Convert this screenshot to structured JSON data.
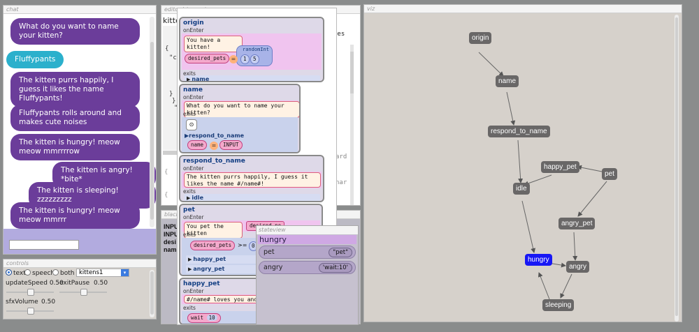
{
  "chat": {
    "panel_title": "chat",
    "messages": [
      {
        "from": "sys",
        "text": "What do you want to name your kitten?"
      },
      {
        "from": "user",
        "text": "Fluffypants"
      },
      {
        "from": "sys",
        "text": "The kitten purrs happily, I guess it likes the name Fluffypants!"
      },
      {
        "from": "sys",
        "text": "Fluffypants rolls around and makes cute noises"
      },
      {
        "from": "sys",
        "text": "The kitten is hungry! meow meow mmrrrrow"
      },
      {
        "from": "sys",
        "text": "The kitten is angry! *bite*"
      },
      {
        "from": "sys",
        "text": "The kitten is sleeping! zzzzzzzzz"
      },
      {
        "from": "sys",
        "text": "The kitten is hungry! meow meow mmrrr"
      }
    ]
  },
  "controls": {
    "panel_title": "controls",
    "modes": [
      "text",
      "speech",
      "both"
    ],
    "selected_mode": "text",
    "story_select": "kittens1",
    "update_speed_label": "updateSpeed",
    "update_speed_value": "0.50",
    "exit_pause_label": "exitPause",
    "exit_pause_value": "0.50",
    "sfx_volume_label": "sfxVolume",
    "sfx_volume_value": "0.50"
  },
  "editor": {
    "panel_title": "editor",
    "inspector_tab": "inspector",
    "title_fragment": "kitte",
    "code_lines": [
      "{",
      "\"c",
      "}",
      "},",
      "\"i"
    ],
    "right_fragments": [
      "tes",
      "ard",
      "nar"
    ],
    "bracket_fragments": [
      "{",
      "{"
    ]
  },
  "blackboard": {
    "panel_title": "blackb",
    "lines": [
      "INPU",
      "INPU",
      "desi",
      "nam"
    ]
  },
  "inspector": {
    "nodes": [
      {
        "name": "origin",
        "on_enter": "onEnter",
        "say": "You have a kitten!",
        "var": "desired_pets",
        "op": "=",
        "func": "randomInt",
        "args": [
          "1",
          "5"
        ],
        "exits_label": "exits",
        "exits": [
          "name"
        ]
      },
      {
        "name": "name",
        "on_enter": "onEnter",
        "say": "What do you want to name your kitten?",
        "exits_label": "exits",
        "exits": [
          "respond_to_name"
        ],
        "var": "name",
        "op": "=",
        "value": "INPUT"
      },
      {
        "name": "respond_to_name",
        "on_enter": "onEnter",
        "say": "The kitten purrs happily, I guess it likes the name #/name#!",
        "exits_label": "exits",
        "exits": [
          "idle"
        ]
      },
      {
        "name": "pet",
        "on_enter": "onEnter",
        "say": "You pet the kitten",
        "var_chip": "desired_pe",
        "exits_label": "exits",
        "cond_var": "desired_pets",
        "cond_op": ">=",
        "cond_val": "0",
        "exits": [
          "happy_pet",
          "angry_pet"
        ]
      },
      {
        "name": "happy_pet",
        "on_enter": "onEnter",
        "say": "#/name# loves you and is",
        "exits_label": "exits",
        "wait_label": "wait",
        "wait_val": "10"
      }
    ]
  },
  "stateview": {
    "panel_title": "stateview",
    "state": "hungry",
    "rows": [
      {
        "key": "pet",
        "value": "\"pet\""
      },
      {
        "key": "angry",
        "value": "'wait:10'"
      }
    ]
  },
  "viz": {
    "panel_title": "viz",
    "active_color": "#1717f5",
    "node_color": "#696767",
    "nodes": [
      "origin",
      "name",
      "respond_to_name",
      "happy_pet",
      "pet",
      "idle",
      "angry_pet",
      "hungry",
      "angry",
      "sleeping"
    ],
    "active_node": "hungry"
  }
}
